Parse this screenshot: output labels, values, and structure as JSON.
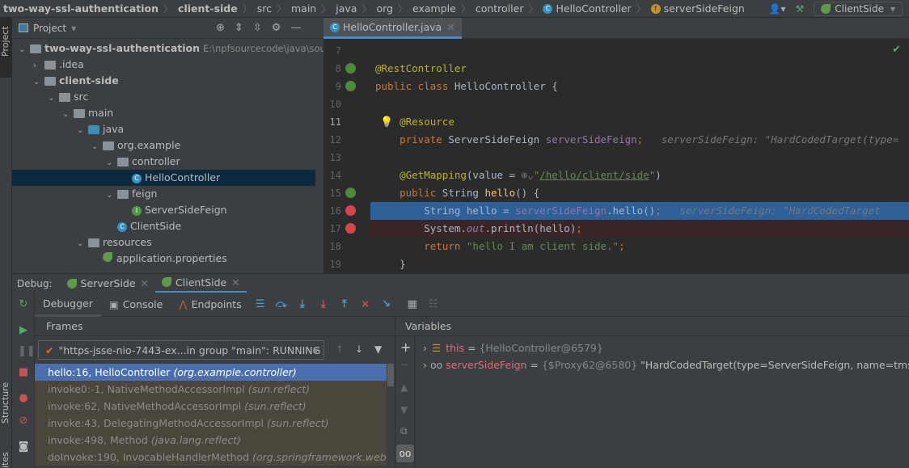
{
  "breadcrumb": {
    "items": [
      "two-way-ssl-authentication",
      "client-side",
      "src",
      "main",
      "java",
      "org",
      "example",
      "controller",
      "HelloController",
      "serverSideFeign"
    ],
    "run_config": "ClientSide"
  },
  "left_bar": {
    "project": "Project",
    "structure": "Structure",
    "favorites": "ites"
  },
  "project": {
    "title": "Project",
    "tree": [
      {
        "label": "two-way-ssl-authentication",
        "extra": "E:\\npfsourcecode\\java\\sourc",
        "depth": 0,
        "expanded": true,
        "bold": true,
        "icon": "module"
      },
      {
        "label": ".idea",
        "depth": 1,
        "expanded": false,
        "icon": "folder"
      },
      {
        "label": "client-side",
        "depth": 1,
        "expanded": true,
        "bold": true,
        "icon": "module"
      },
      {
        "label": "src",
        "depth": 2,
        "expanded": true,
        "icon": "folder"
      },
      {
        "label": "main",
        "depth": 3,
        "expanded": true,
        "icon": "folder"
      },
      {
        "label": "java",
        "depth": 4,
        "expanded": true,
        "icon": "source-folder"
      },
      {
        "label": "org.example",
        "depth": 5,
        "expanded": true,
        "icon": "package"
      },
      {
        "label": "controller",
        "depth": 6,
        "expanded": true,
        "icon": "package"
      },
      {
        "label": "HelloController",
        "depth": 7,
        "icon": "class",
        "selected": true
      },
      {
        "label": "feign",
        "depth": 6,
        "expanded": true,
        "icon": "package"
      },
      {
        "label": "ServerSideFeign",
        "depth": 7,
        "icon": "interface"
      },
      {
        "label": "ClientSide",
        "depth": 6,
        "icon": "spring-boot-class"
      },
      {
        "label": "resources",
        "depth": 4,
        "expanded": true,
        "icon": "resources-folder"
      },
      {
        "label": "application.properties",
        "depth": 5,
        "icon": "spring-properties"
      }
    ]
  },
  "editor": {
    "tab": "HelloController.java",
    "lines": [
      {
        "n": "7",
        "html": ""
      },
      {
        "n": "8",
        "html": "<span class='ann'>@RestController</span>"
      },
      {
        "n": "9",
        "html": "<span class='kw'>public class </span>HelloController {"
      },
      {
        "n": "10",
        "html": ""
      },
      {
        "n": "11",
        "html": "    <span class='ann'>@Resource</span>"
      },
      {
        "n": "12",
        "html": "    <span class='kw'>private </span>ServerSideFeign <span class='fld'>serverSideFeign</span><span class='kw'>;</span>   <span class='hint'>serverSideFeign: \"HardCodedTarget(type=</span>"
      },
      {
        "n": "13",
        "html": ""
      },
      {
        "n": "14",
        "html": "    <span class='ann'>@GetMapping</span>(value = <span class='hint'>⊕⌄</span><span class='str'>\"<u>/hello/client/side</u>\"</span>)"
      },
      {
        "n": "15",
        "html": "    <span class='kw'>public </span>String <span class='fn'>hello</span>() {"
      },
      {
        "n": "16",
        "html": "        String hello = <span class='fld'>serverSideFeign</span>.hello()<span class='kw'>;</span>   <span class='hint'>serverSideFeign: \"HardCodedTarget</span>"
      },
      {
        "n": "17",
        "html": "        System.<span class='it'>out</span>.println(hello)<span class='kw'>;</span>"
      },
      {
        "n": "18",
        "html": "        <span class='kw'>return </span><span class='str'>\"hello I am client side.\"</span><span class='kw'>;</span>"
      },
      {
        "n": "19",
        "html": "    }"
      }
    ]
  },
  "debug": {
    "label": "Debug:",
    "sessions": [
      "ServerSide",
      "ClientSide"
    ],
    "tabs": [
      "Debugger",
      "Console",
      "Endpoints"
    ],
    "frames_title": "Frames",
    "variables_title": "Variables",
    "thread": "\"https-jsse-nio-7443-ex...in group \"main\": RUNNING",
    "frames": [
      {
        "method": "hello:16, HelloController",
        "pkg": "(org.example.controller)"
      },
      {
        "method": "invoke0:-1, NativeMethodAccessorImpl",
        "pkg": "(sun.reflect)"
      },
      {
        "method": "invoke:62, NativeMethodAccessorImpl",
        "pkg": "(sun.reflect)"
      },
      {
        "method": "invoke:43, DelegatingMethodAccessorImpl",
        "pkg": "(sun.reflect)"
      },
      {
        "method": "invoke:498, Method",
        "pkg": "(java.lang.reflect)"
      },
      {
        "method": "doInvoke:190, InvocableHandlerMethod",
        "pkg": "(org.springframework.web.meth"
      }
    ],
    "variables": [
      {
        "name": "this",
        "eq": " = ",
        "value": "{HelloController@6579}",
        "extra": ""
      },
      {
        "name": "serverSideFeign",
        "eq": " = ",
        "value": "{$Proxy62@6580}",
        "extra": " \"HardCodedTarget(type=ServerSideFeign, name=tms, url=ht"
      }
    ]
  }
}
